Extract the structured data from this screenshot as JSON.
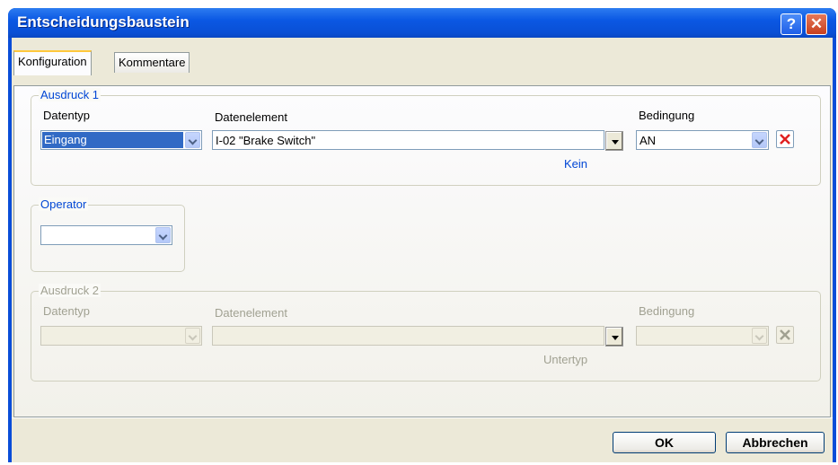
{
  "window": {
    "title": "Entscheidungsbaustein",
    "help_glyph": "?",
    "close_glyph": "✕"
  },
  "tabs": [
    {
      "label": "Konfiguration",
      "active": true
    },
    {
      "label": "Kommentare",
      "active": false
    }
  ],
  "expr1": {
    "legend": "Ausdruck 1",
    "datatype_label": "Datentyp",
    "datatype_value": "Eingang",
    "element_label": "Datenelement",
    "element_value": "I-02 \"Brake Switch\"",
    "sublabel": "Kein",
    "condition_label": "Bedingung",
    "condition_value": "AN"
  },
  "operator": {
    "legend": "Operator",
    "value": ""
  },
  "expr2": {
    "legend": "Ausdruck 2",
    "datatype_label": "Datentyp",
    "datatype_value": "",
    "element_label": "Datenelement",
    "element_value": "",
    "sublabel": "Untertyp",
    "condition_label": "Bedingung",
    "condition_value": ""
  },
  "buttons": {
    "ok": "OK",
    "cancel": "Abbrechen"
  },
  "colors": {
    "title_bar": "#0b58e4",
    "accent_blue": "#0046d5",
    "delete_red": "#e02020"
  }
}
